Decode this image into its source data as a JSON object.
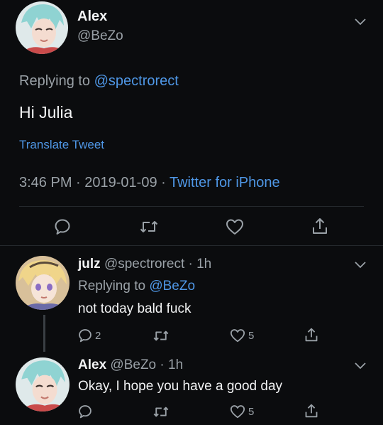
{
  "main_tweet": {
    "name": "Alex",
    "handle": "@BeZo",
    "replying_prefix": "Replying to ",
    "replying_to": "@spectrorect",
    "text": "Hi Julia",
    "translate": "Translate Tweet",
    "time": "3:46 PM · 2019-01-09 · ",
    "source": "Twitter for iPhone"
  },
  "reply_1": {
    "name": "julz",
    "handle_time": "@spectrorect · 1h",
    "replying_prefix": "Replying to ",
    "replying_to": "@BeZo",
    "text": "not today bald fuck",
    "reply_count": "2",
    "like_count": "5"
  },
  "reply_2": {
    "name": "Alex",
    "handle_time": "@BeZo · 1h",
    "text": "Okay, I hope you have a good day",
    "like_count": "5"
  },
  "colors": {
    "background": "#0b0c0e",
    "link": "#4f97e6",
    "muted": "#9aa1a7"
  },
  "icons": [
    "reply-icon",
    "retweet-icon",
    "like-icon",
    "share-icon",
    "chevron-down-icon"
  ]
}
